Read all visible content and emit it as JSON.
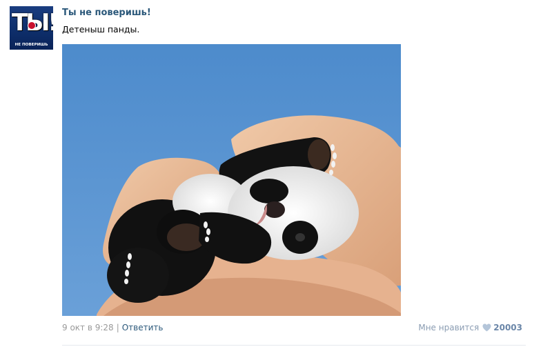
{
  "post": {
    "avatar": {
      "logo_text": "ТЫ!",
      "sub_text": "НЕ ПОВЕРИШЬ"
    },
    "author": "Ты не поверишь!",
    "text": "Детеныш панды.",
    "photo": {
      "icon": "panda-cub-photo"
    },
    "date": "9 окт в 9:28",
    "separator": "|",
    "reply_label": "Ответить",
    "like_label": "Мне нравится",
    "like_count": "20003",
    "colors": {
      "link": "#2b587a",
      "meta": "#999999",
      "like_heart": "#b4c5d9",
      "photo_background": "#4a87c9"
    }
  }
}
